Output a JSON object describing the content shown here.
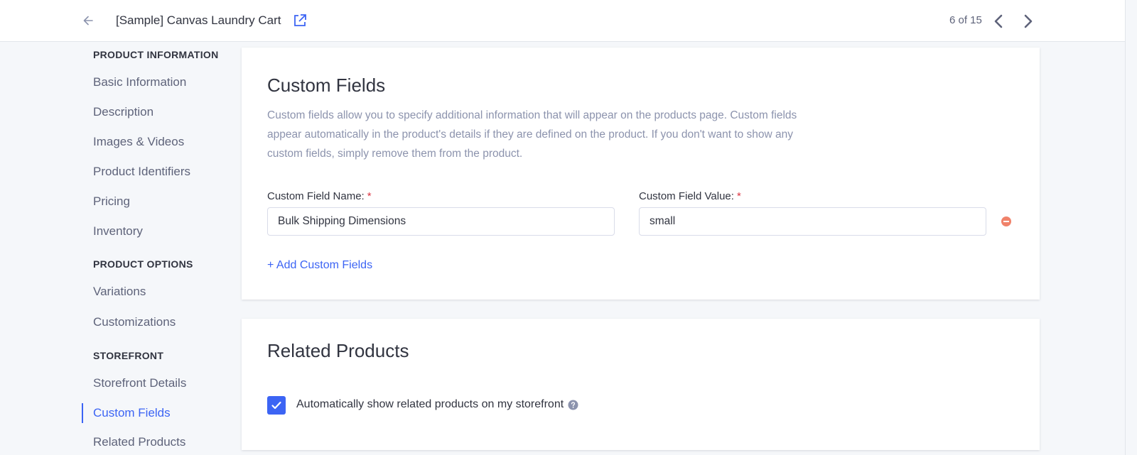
{
  "header": {
    "product_title": "[Sample] Canvas Laundry Cart",
    "pager": "6 of 15",
    "back_icon": "arrow-left-icon",
    "external_icon": "open-in-new-icon",
    "prev_icon": "chevron-left-icon",
    "next_icon": "chevron-right-icon"
  },
  "sidebar": {
    "sections": [
      {
        "heading": "PRODUCT INFORMATION",
        "items": [
          "Basic Information",
          "Description",
          "Images & Videos",
          "Product Identifiers",
          "Pricing",
          "Inventory"
        ]
      },
      {
        "heading": "PRODUCT OPTIONS",
        "items": [
          "Variations",
          "Customizations"
        ]
      },
      {
        "heading": "STOREFRONT",
        "items": [
          "Storefront Details",
          "Custom Fields",
          "Related Products"
        ]
      }
    ],
    "active_item": "Custom Fields"
  },
  "custom_fields": {
    "title": "Custom Fields",
    "description": "Custom fields allow you to specify additional information that will appear on the products page. Custom fields appear automatically in the product's details if they are defined on the product. If you don't want to show any custom fields, simply remove them from the product.",
    "name_label": "Custom Field Name:",
    "value_label": "Custom Field Value:",
    "required_mark": "*",
    "name_value": "Bulk Shipping Dimensions",
    "value_value": "small",
    "remove_icon": "remove-circle-icon",
    "add_link": "+ Add Custom Fields"
  },
  "related_products": {
    "title": "Related Products",
    "checkbox_label": "Automatically show related products on my storefront",
    "checkbox_checked": true,
    "help_icon": "help-circle-icon"
  },
  "colors": {
    "accent": "#3c64f4",
    "required": "#db3643",
    "remove": "#f0826a"
  }
}
